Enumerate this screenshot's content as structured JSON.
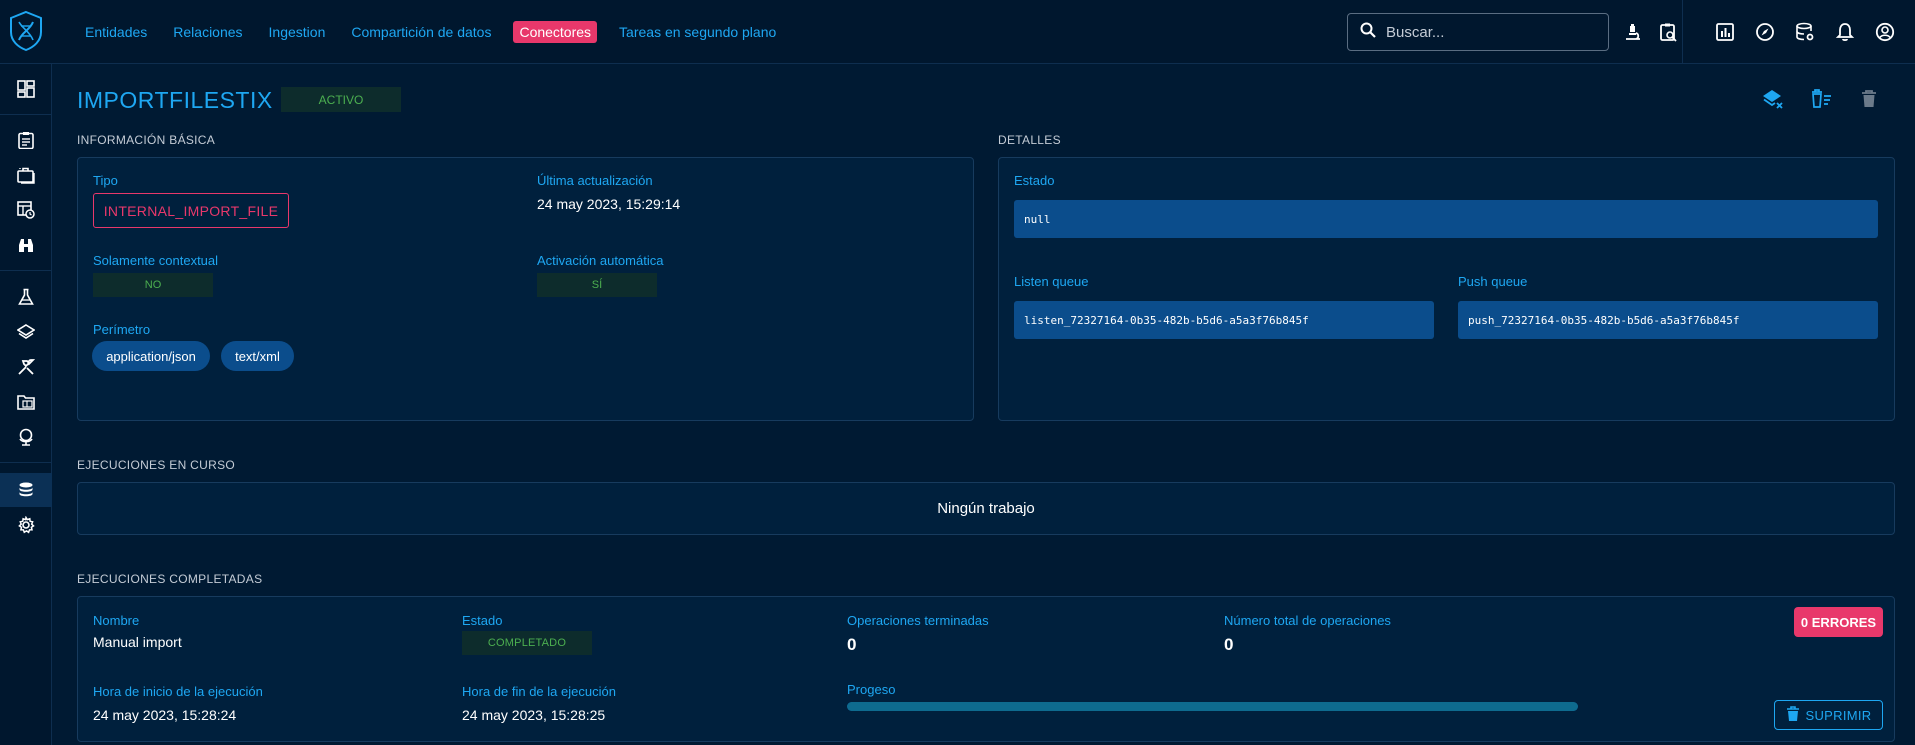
{
  "nav": {
    "items": [
      {
        "label": "Entidades"
      },
      {
        "label": "Relaciones"
      },
      {
        "label": "Ingestion"
      },
      {
        "label": "Compartición de datos"
      },
      {
        "label": "Conectores"
      },
      {
        "label": "Tareas en segundo plano"
      }
    ],
    "active": "Conectores"
  },
  "search": {
    "placeholder": "Buscar..."
  },
  "top_icons": [
    "microscope-icon",
    "clipboard-search-icon",
    "chart-box-icon",
    "compass-icon",
    "database-cog-icon",
    "bell-icon",
    "account-circle-icon"
  ],
  "sidebar_icons": [
    "dashboard-icon",
    "clipboard-text-icon",
    "briefcase-icon",
    "table-clock-icon",
    "binoculars-icon",
    "flask-icon",
    "layers-icon",
    "hammer-wrench-icon",
    "folder-table-icon",
    "globe-icon",
    "database-icon",
    "cog-icon"
  ],
  "connector": {
    "name": "IMPORTFILESTIX",
    "status": "ACTIVO",
    "header_actions": [
      "layers-remove-icon",
      "delete-sweep-icon",
      "trash-icon"
    ]
  },
  "basic_info": {
    "section_title": "INFORMACIÓN BÁSICA",
    "type_label": "Tipo",
    "type_value": "INTERNAL_IMPORT_FILE",
    "updated_label": "Última actualización",
    "updated_value": "24 may 2023, 15:29:14",
    "contextual_label": "Solamente contextual",
    "contextual_value": "NO",
    "auto_label": "Activación automática",
    "auto_value": "SÍ",
    "scope_label": "Perímetro",
    "scope": [
      "application/json",
      "text/xml"
    ]
  },
  "details": {
    "section_title": "DETALLES",
    "state_label": "Estado",
    "state_value": "null",
    "listen_label": "Listen queue",
    "listen_value": "listen_72327164-0b35-482b-b5d6-a5a3f76b845f",
    "push_label": "Push queue",
    "push_value": "push_72327164-0b35-482b-b5d6-a5a3f76b845f"
  },
  "running": {
    "section_title": "EJECUCIONES EN CURSO",
    "empty_text": "Ningún trabajo"
  },
  "completed": {
    "section_title": "EJECUCIONES COMPLETADAS",
    "name_label": "Nombre",
    "name_value": "Manual import",
    "state_label": "Estado",
    "state_value": "COMPLETADO",
    "ops_done_label": "Operaciones terminadas",
    "ops_done_value": "0",
    "ops_total_label": "Número total de operaciones",
    "ops_total_value": "0",
    "errors_label": "0 ERRORES",
    "start_label": "Hora de inicio de la ejecución",
    "start_value": "24 may 2023, 15:28:24",
    "end_label": "Hora de fin de la ejecución",
    "end_value": "24 may 2023, 15:28:25",
    "progress_label": "Progeso",
    "progress": 1.0,
    "delete_label": "SUPRIMIR"
  }
}
